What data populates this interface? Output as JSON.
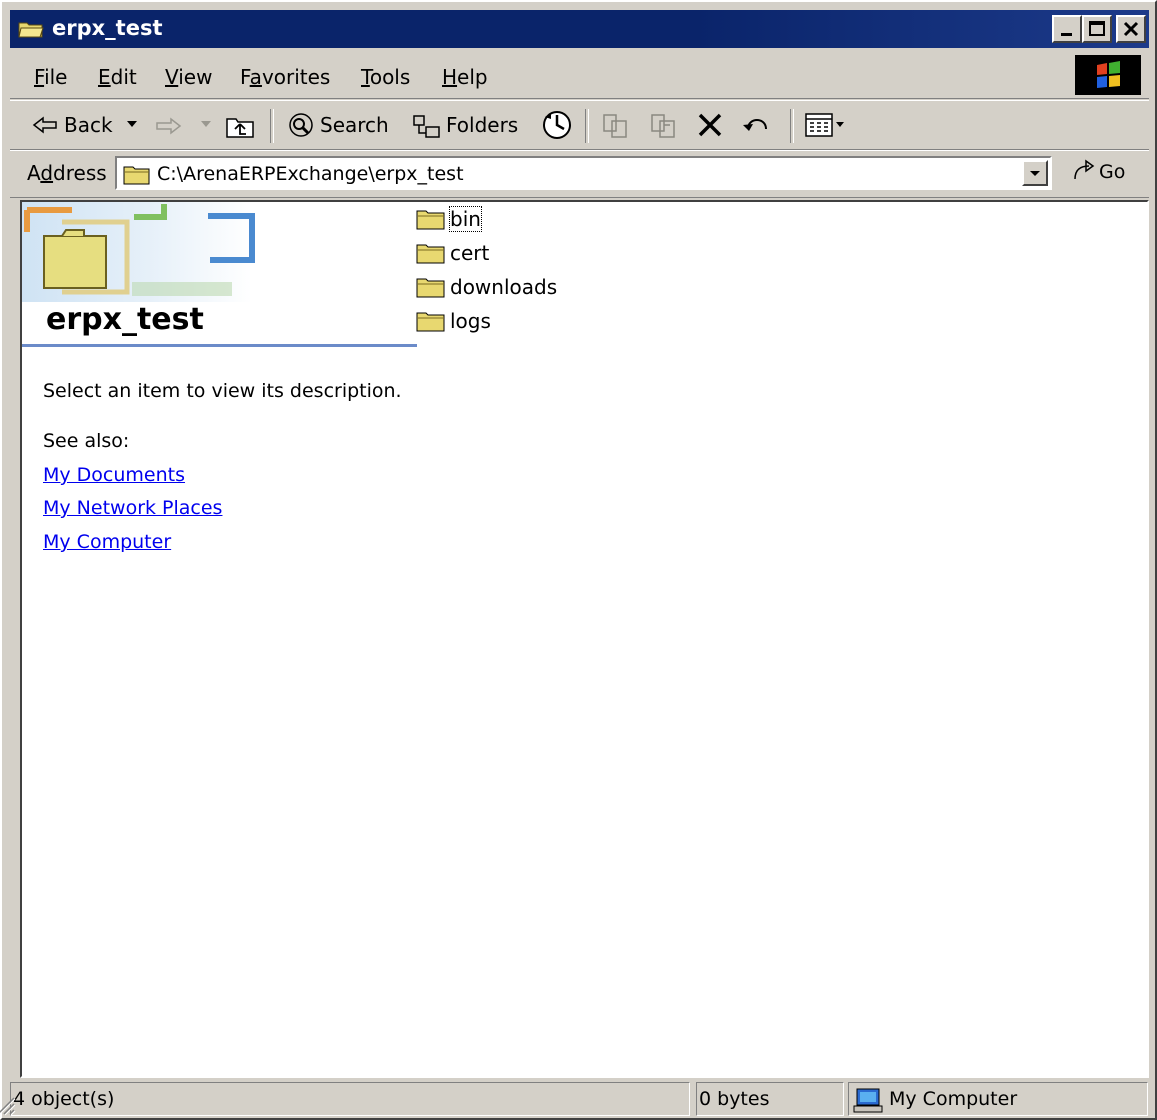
{
  "window": {
    "title": "erpx_test"
  },
  "menubar": {
    "items": [
      {
        "pre": "",
        "u": "F",
        "post": "ile"
      },
      {
        "pre": "",
        "u": "E",
        "post": "dit"
      },
      {
        "pre": "",
        "u": "V",
        "post": "iew"
      },
      {
        "pre": "F",
        "u": "a",
        "post": "vorites"
      },
      {
        "pre": "",
        "u": "T",
        "post": "ools"
      },
      {
        "pre": "",
        "u": "H",
        "post": "elp"
      }
    ]
  },
  "toolbar": {
    "back_label": "Back",
    "search_label": "Search",
    "folders_label": "Folders"
  },
  "address": {
    "label_pre": "A",
    "label_u": "d",
    "label_post": "dress",
    "path": "C:\\ArenaERPExchange\\erpx_test",
    "go_label": "Go"
  },
  "webview": {
    "folder_name": "erpx_test",
    "description": "Select an item to view its description.",
    "see_also": "See also:",
    "links": [
      "My Documents",
      "My Network Places",
      "My Computer"
    ]
  },
  "files": [
    "bin",
    "cert",
    "downloads",
    "logs"
  ],
  "statusbar": {
    "objects": "4 object(s)",
    "size": "0 bytes",
    "zone": "My Computer"
  },
  "colors": {
    "titlebar": "#0a246a",
    "chrome": "#d4d0c8",
    "link": "#0000ee",
    "folder": "#e8d870"
  }
}
